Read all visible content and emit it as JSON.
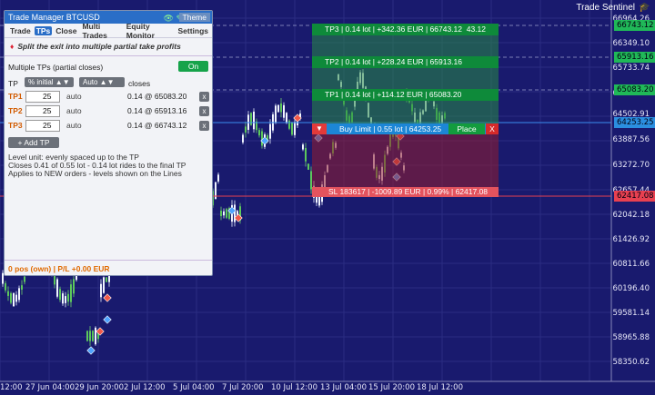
{
  "chart": {
    "brand": "Trade Sentinel",
    "price_axis": [
      "66964.26",
      "66349.10",
      "65733.74",
      "65118.27",
      "64502.91",
      "63887.56",
      "63272.70",
      "62657.44",
      "62042.18",
      "61426.92",
      "60811.66",
      "60196.40",
      "59581.14",
      "58965.88",
      "58350.62"
    ],
    "time_axis": [
      "12:00",
      "27 Jun 04:00",
      "29 Jun 20:00",
      "2 Jul 12:00",
      "5 Jul 04:00",
      "7 Jul 20:00",
      "10 Jul 12:00",
      "13 Jul 04:00",
      "15 Jul 20:00",
      "18 Jul 12:00"
    ],
    "price_tags": [
      {
        "label": "66743.12",
        "color": "#20b858"
      },
      {
        "label": "65913.16",
        "color": "#20b858"
      },
      {
        "label": "65083.20",
        "color": "#20b858"
      },
      {
        "label": "64253.25",
        "color": "#2b8ee0"
      },
      {
        "label": "62417.08",
        "color": "#e84050"
      }
    ],
    "tp_lines": [
      {
        "text": "TP3 | 0.14 lot | +342.36 EUR | 66743.12",
        "extra": "43.12"
      },
      {
        "text": "TP2 | 0.14 lot | +228.24 EUR | 65913.16",
        "extra": ""
      },
      {
        "text": "TP1 | 0.14 lot | +114.12 EUR | 65083.20",
        "extra": ""
      }
    ],
    "buy_line": {
      "arrow": "▼",
      "text": "Buy Limit | 0.55 lot | 64253.25",
      "place": "Place",
      "close": "X"
    },
    "sl_line": "SL 183617 | -1009.89 EUR | 0.99% | 62417.08"
  },
  "panel": {
    "title": "Trade Manager  BTCUSD",
    "icons": "👁 ✎",
    "theme": "Theme",
    "tabs": [
      "Trade",
      "TPs",
      "Close",
      "Multi Trades",
      "Equity Monitor",
      "Settings"
    ],
    "active_tab": "TPs",
    "note": "Split the exit into multiple partial take profits",
    "multiple_label": "Multiple TPs (partial closes)",
    "on_label": "On",
    "tp_col": "TP",
    "mode_pill": "% initial ▲▼",
    "auto_pill": "Auto ▲▼",
    "closes": "closes",
    "rows": [
      {
        "name": "TP1",
        "value": "25",
        "auto": "auto",
        "lots": "0.14 @ 65083.20",
        "x": "x"
      },
      {
        "name": "TP2",
        "value": "25",
        "auto": "auto",
        "lots": "0.14 @ 65913.16",
        "x": "x"
      },
      {
        "name": "TP3",
        "value": "25",
        "auto": "auto",
        "lots": "0.14 @ 66743.12",
        "x": "x"
      }
    ],
    "add_tp": "+ Add TP",
    "info": [
      "Level unit: evenly spaced up to the TP",
      "Closes 0.41 of 0.55 lot - 0.14 lot rides to the final TP",
      "Applies to NEW orders - levels shown on the Lines"
    ],
    "footer": "0 pos (own)  |  P/L +0.00 EUR"
  }
}
